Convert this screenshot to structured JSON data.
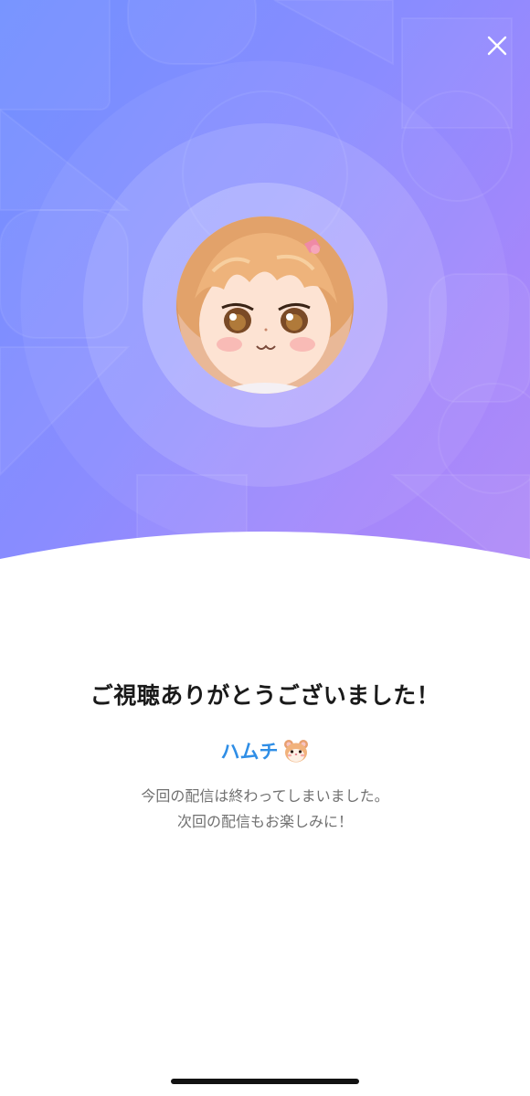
{
  "hero": {
    "gradient_start": "#7190ff",
    "gradient_end": "#b18cf7",
    "close_icon": "close-icon",
    "avatar_alt": "streamer avatar"
  },
  "content": {
    "title": "ご視聴ありがとうございました！",
    "streamer_name": "ハムチ",
    "streamer_emoji_icon": "hamster-icon",
    "message_line1": "今回の配信は終わってしまいました。",
    "message_line2": "次回の配信もお楽しみに！",
    "name_color": "#2f8ee6"
  }
}
